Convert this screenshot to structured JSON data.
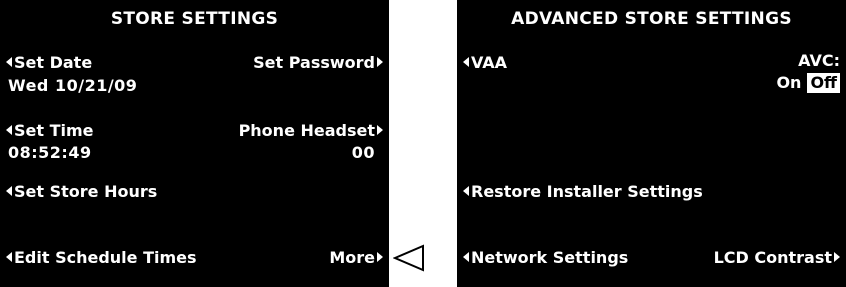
{
  "left_screen": {
    "title": "STORE SETTINGS",
    "set_date_label": "Set Date",
    "set_date_value": "Wed 10/21/09",
    "set_password_label": "Set Password",
    "set_time_label": "Set Time",
    "set_time_value": "08:52:49",
    "phone_headset_label": "Phone Headset",
    "phone_headset_value": "00",
    "set_store_hours_label": "Set Store Hours",
    "edit_schedule_times_label": "Edit Schedule Times",
    "more_label": "More"
  },
  "right_screen": {
    "title": "ADVANCED STORE SETTINGS",
    "vaa_label": "VAA",
    "avc_label": "AVC:",
    "avc_on": "On",
    "avc_off": "Off",
    "restore_label": "Restore Installer Settings",
    "network_label": "Network Settings",
    "lcd_label": "LCD Contrast"
  },
  "colors": {
    "screen_bg": "#000000",
    "screen_text": "#ffffff",
    "page_bg": "#ffffff"
  },
  "pointer_icon": "hollow-left-triangle"
}
